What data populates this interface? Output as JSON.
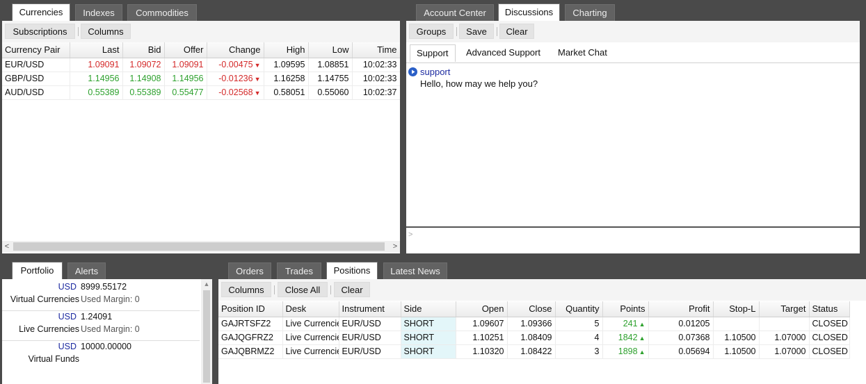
{
  "currencies_panel": {
    "tabs": [
      "Currencies",
      "Indexes",
      "Commodities"
    ],
    "active_tab": "Currencies",
    "toolbar": {
      "subscriptions": "Subscriptions",
      "columns": "Columns"
    },
    "headers": [
      "Currency Pair",
      "Last",
      "Bid",
      "Offer",
      "Change",
      "High",
      "Low",
      "Time"
    ],
    "rows": [
      {
        "pair": "EUR/USD",
        "last": "1.09091",
        "bid": "1.09072",
        "offer": "1.09091",
        "change": "-0.00475",
        "high": "1.09595",
        "low": "1.08851",
        "time": "10:02:33",
        "color": "red"
      },
      {
        "pair": "GBP/USD",
        "last": "1.14956",
        "bid": "1.14908",
        "offer": "1.14956",
        "change": "-0.01236",
        "high": "1.16258",
        "low": "1.14755",
        "time": "10:02:33",
        "color": "green"
      },
      {
        "pair": "AUD/USD",
        "last": "0.55389",
        "bid": "0.55389",
        "offer": "0.55477",
        "change": "-0.02568",
        "high": "0.58051",
        "low": "0.55060",
        "time": "10:02:37",
        "color": "green"
      }
    ],
    "scroll_left": "<",
    "scroll_right": ">"
  },
  "discussions_panel": {
    "tabs": [
      "Account Center",
      "Discussions",
      "Charting"
    ],
    "active_tab": "Discussions",
    "toolbar": {
      "groups": "Groups",
      "save": "Save",
      "clear": "Clear"
    },
    "subtabs": [
      "Support",
      "Advanced Support",
      "Market Chat"
    ],
    "active_subtab": "Support",
    "message": {
      "sender": "support",
      "text": "Hello, how may we help you?"
    },
    "input_prompt": ">"
  },
  "portfolio_panel": {
    "tabs": [
      "Portfolio",
      "Alerts"
    ],
    "active_tab": "Portfolio",
    "items": [
      {
        "currency": "USD",
        "value": "8999.55172",
        "name": "Virtual Currencies",
        "margin": "Used Margin:  0"
      },
      {
        "currency": "USD",
        "value": "1.24091",
        "name": "Live Currencies",
        "margin": "Used Margin:  0"
      },
      {
        "currency": "USD",
        "value": "10000.00000",
        "name": "Virtual Funds",
        "margin": ""
      }
    ]
  },
  "positions_panel": {
    "tabs": [
      "Orders",
      "Trades",
      "Positions",
      "Latest News"
    ],
    "active_tab": "Positions",
    "toolbar": {
      "columns": "Columns",
      "close_all": "Close All",
      "clear": "Clear"
    },
    "headers": [
      "Position ID",
      "Desk",
      "Instrument",
      "Side",
      "Open",
      "Close",
      "Quantity",
      "Points",
      "Profit",
      "Stop-L",
      "Target",
      "Status"
    ],
    "rows": [
      {
        "id": "GAJRTSFZ2",
        "desk": "Live Currencies",
        "instrument": "EUR/USD",
        "side": "SHORT",
        "open": "1.09607",
        "close": "1.09366",
        "quantity": "5",
        "points": "241",
        "profit": "0.01205",
        "stop": "",
        "target": "",
        "status": "CLOSED"
      },
      {
        "id": "GAJQGFRZ2",
        "desk": "Live Currencies",
        "instrument": "EUR/USD",
        "side": "SHORT",
        "open": "1.10251",
        "close": "1.08409",
        "quantity": "4",
        "points": "1842",
        "profit": "0.07368",
        "stop": "1.10500",
        "target": "1.07000",
        "status": "CLOSED"
      },
      {
        "id": "GAJQBRMZ2",
        "desk": "Live Currencies",
        "instrument": "EUR/USD",
        "side": "SHORT",
        "open": "1.10320",
        "close": "1.08422",
        "quantity": "3",
        "points": "1898",
        "profit": "0.05694",
        "stop": "1.10500",
        "target": "1.07000",
        "status": "CLOSED"
      }
    ]
  },
  "colors": {
    "up": "#2ea12e",
    "down": "#d42a2a",
    "link_blue": "#1c2aa0",
    "frame": "#4a4a4a"
  },
  "icons": {
    "change_down": "▼",
    "points_up": "▲",
    "message_icon": "play-circle-icon"
  }
}
